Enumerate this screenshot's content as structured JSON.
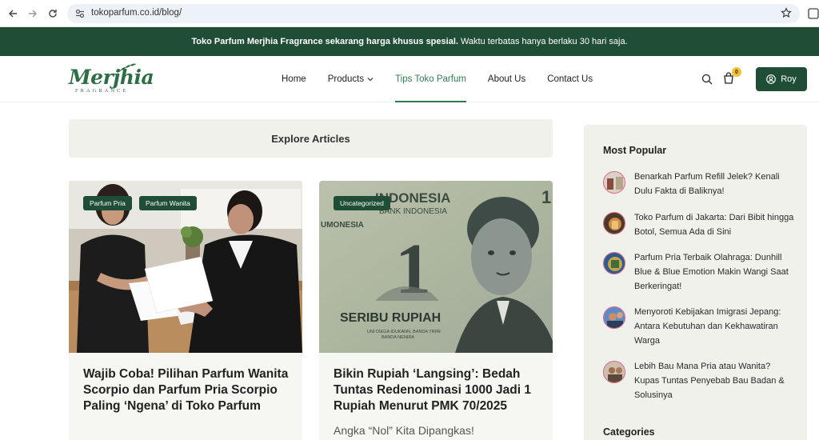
{
  "browser": {
    "url": "tokoparfum.co.id/blog/"
  },
  "announcement": {
    "bold": "Toko Parfum Merjhia Fragrance sekarang harga khusus spesial.",
    "text": "Waktu terbatas hanya berlaku 30 hari saja."
  },
  "logo": {
    "name": "Merjhia",
    "sub": "FRAGRANCE"
  },
  "nav": {
    "home": "Home",
    "products": "Products",
    "tips": "Tips Toko Parfum",
    "about": "About Us",
    "contact": "Contact Us"
  },
  "header": {
    "cart_count": "0",
    "user_label": "Roy"
  },
  "main": {
    "explore_label": "Explore Articles"
  },
  "articles": [
    {
      "tags": [
        "Parfum Pria",
        "Parfum Wanita"
      ],
      "title": "Wajib Coba! Pilihan Parfum Wanita Scorpio dan Parfum Pria Scorpio Paling ‘Ngena’ di Toko Parfum",
      "excerpt": ""
    },
    {
      "tags": [
        "Uncategorized"
      ],
      "title": "Bikin Rupiah ‘Langsing’: Bedah Tuntas Redenominasi 1000 Jadi 1 Rupiah Menurut PMK 70/2025",
      "excerpt": "Angka “Nol” Kita Dipangkas!",
      "banknote": {
        "country": "INDONESIA",
        "bank": "BANK INDONESIA",
        "edge_text": "UMONESIA",
        "denomination": "1",
        "words": "SERIBU RUPIAH",
        "fine_print_1": "UNI DIEGA IDUKANN, BANDA TRIIN",
        "fine_print_2": "BANDA NENIRA"
      }
    }
  ],
  "sidebar": {
    "popular_title": "Most Popular",
    "popular": [
      "Benarkah Parfum Refill Jelek? Kenali Dulu Fakta di Baliknya!",
      "Toko Parfum di Jakarta: Dari Bibit hingga Botol, Semua Ada di Sini",
      "Parfum Pria Terbaik Olahraga: Dunhill Blue & Blue Emotion Makin Wangi Saat Berkeringat!",
      "Menyoroti Kebijakan Imigrasi Jepang: Antara Kebutuhan dan Kekhawatiran Warga",
      "Lebih Bau Mana Pria atau Wanita? Kupas Tuntas Penyebab Bau Badan & Solusinya"
    ],
    "categories_title": "Categories"
  }
}
